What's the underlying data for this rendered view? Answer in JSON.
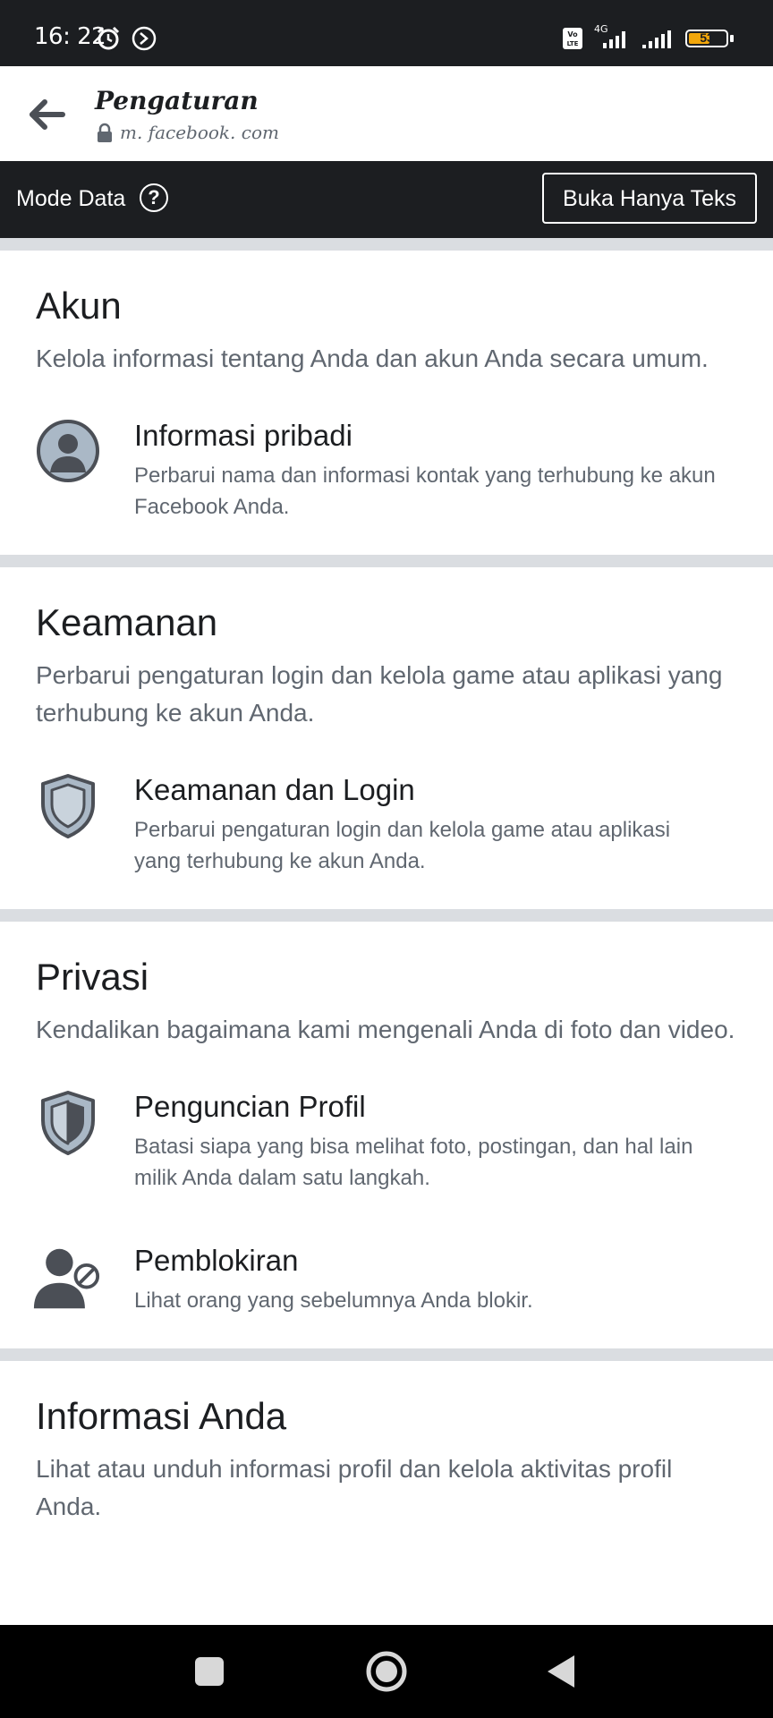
{
  "status_bar": {
    "time": "16: 22",
    "network": "4G",
    "battery": "53",
    "battery_level": 0.53
  },
  "browser": {
    "title": "Pengaturan",
    "url": "m. facebook. com"
  },
  "data_mode": {
    "label": "Mode Data",
    "help_symbol": "?",
    "text_only_button": "Buka Hanya Teks"
  },
  "sections": [
    {
      "title": "Akun",
      "description": "Kelola informasi tentang Anda dan akun Anda secara umum.",
      "items": [
        {
          "icon": "person-circle-icon",
          "title": "Informasi pribadi",
          "description": "Perbarui nama dan informasi kontak yang terhubung ke akun Facebook Anda."
        }
      ]
    },
    {
      "title": "Keamanan",
      "description": "Perbarui pengaturan login dan kelola game atau aplikasi yang terhubung ke akun Anda.",
      "items": [
        {
          "icon": "shield-icon",
          "title": "Keamanan dan Login",
          "description": "Perbarui pengaturan login dan kelola game atau aplikasi yang terhubung ke akun Anda."
        }
      ]
    },
    {
      "title": "Privasi",
      "description": "Kendalikan bagaimana kami mengenali Anda di foto dan video.",
      "items": [
        {
          "icon": "shield-lock-icon",
          "title": "Penguncian Profil",
          "description": "Batasi siapa yang bisa melihat foto, postingan, dan hal lain milik Anda dalam satu langkah."
        },
        {
          "icon": "person-blocked-icon",
          "title": "Pemblokiran",
          "description": "Lihat orang yang sebelumnya Anda blokir."
        }
      ]
    },
    {
      "title": "Informasi Anda",
      "description": "Lihat atau unduh informasi profil dan kelola aktivitas profil Anda."
    }
  ],
  "colors": {
    "dark_bar": "#1c1e21",
    "divider": "#dadde1",
    "secondary_text": "#606770",
    "icon_fill": "#aab8c6",
    "icon_dark": "#4b4f56"
  }
}
